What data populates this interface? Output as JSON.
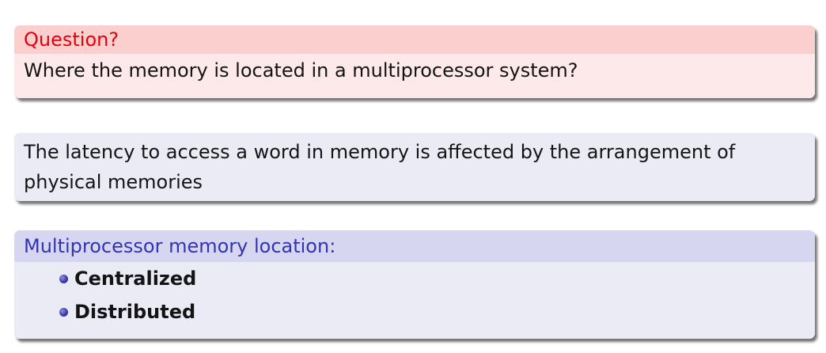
{
  "question_block": {
    "title": "Question?",
    "body": "Where the memory is located in a multiprocessor system?"
  },
  "latency_block": {
    "body": "The latency to access a word in memory is affected by the arrangement of physical memories"
  },
  "location_block": {
    "title": "Multiprocessor memory location:",
    "items": [
      {
        "label": "Centralized"
      },
      {
        "label": "Distributed"
      }
    ]
  },
  "colors": {
    "alert_title": "#e6000a",
    "alert_title_bg": "#fccfcf",
    "alert_body_bg": "#fde9e9",
    "block_title": "#3333b3",
    "block_title_bg": "#d6d6f1",
    "block_body_bg": "#ebebf6"
  }
}
